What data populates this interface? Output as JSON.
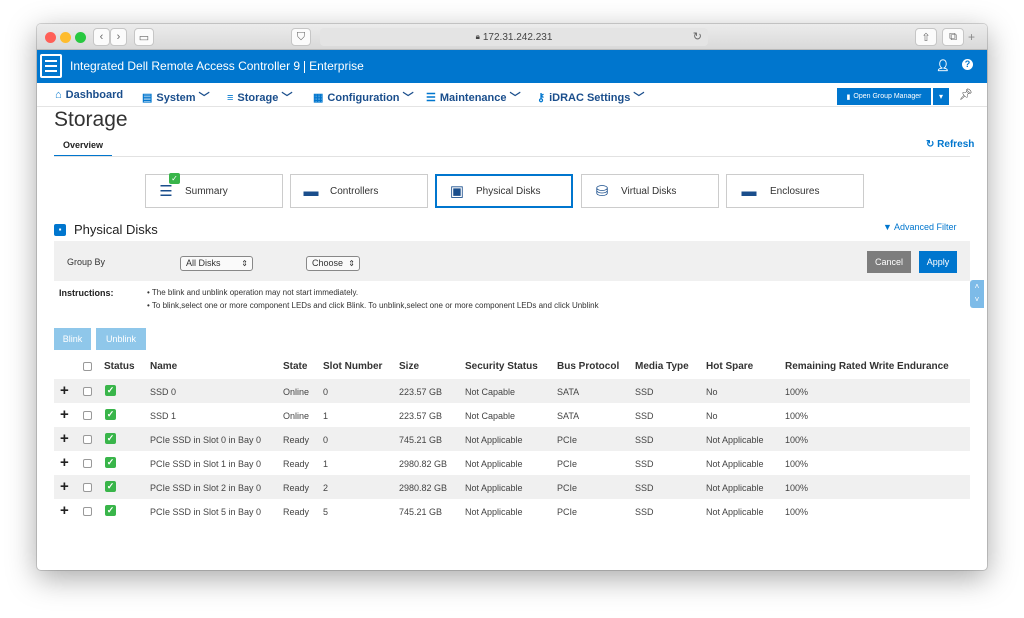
{
  "browser": {
    "url": "172.31.242.231",
    "nav_back": "‹",
    "nav_forward": "›"
  },
  "header": {
    "app_title": "Integrated Dell Remote Access Controller 9",
    "edition": "Enterprise",
    "user_icon": "user-icon",
    "help_icon": "help-icon"
  },
  "nav": {
    "items": [
      {
        "label": "Dashboard",
        "icon": "home-icon"
      },
      {
        "label": "System",
        "icon": "server-icon"
      },
      {
        "label": "Storage",
        "icon": "storage-icon"
      },
      {
        "label": "Configuration",
        "icon": "config-icon"
      },
      {
        "label": "Maintenance",
        "icon": "maintenance-icon"
      },
      {
        "label": "iDRAC Settings",
        "icon": "key-icon"
      }
    ],
    "group_manager": "Open Group Manager"
  },
  "page": {
    "title": "Storage",
    "tab": "Overview",
    "refresh": "Refresh"
  },
  "cards": [
    {
      "label": "Summary",
      "icon": "summary-icon"
    },
    {
      "label": "Controllers",
      "icon": "controller-icon"
    },
    {
      "label": "Physical Disks",
      "icon": "disk-icon"
    },
    {
      "label": "Virtual Disks",
      "icon": "virtual-disk-icon"
    },
    {
      "label": "Enclosures",
      "icon": "enclosure-icon"
    }
  ],
  "section": {
    "title": "Physical Disks",
    "advanced_filter": "Advanced Filter",
    "group_by_label": "Group By",
    "group_by_value": "All Disks",
    "choose_value": "Choose",
    "cancel": "Cancel",
    "apply": "Apply",
    "instructions_label": "Instructions:",
    "instructions": [
      "The blink and unblink operation may not start immediately.",
      "To blink,select one or more component LEDs and click Blink. To unblink,select one or more component LEDs and click Unblink"
    ],
    "blink": "Blink",
    "unblink": "Unblink"
  },
  "table": {
    "headers": [
      "Status",
      "Name",
      "State",
      "Slot Number",
      "Size",
      "Security Status",
      "Bus Protocol",
      "Media Type",
      "Hot Spare",
      "Remaining Rated Write Endurance"
    ],
    "rows": [
      [
        "SSD 0",
        "Online",
        "0",
        "223.57 GB",
        "Not Capable",
        "SATA",
        "SSD",
        "No",
        "100%"
      ],
      [
        "SSD 1",
        "Online",
        "1",
        "223.57 GB",
        "Not Capable",
        "SATA",
        "SSD",
        "No",
        "100%"
      ],
      [
        "PCIe SSD in Slot 0 in Bay 0",
        "Ready",
        "0",
        "745.21 GB",
        "Not Applicable",
        "PCIe",
        "SSD",
        "Not Applicable",
        "100%"
      ],
      [
        "PCIe SSD in Slot 1 in Bay 0",
        "Ready",
        "1",
        "2980.82 GB",
        "Not Applicable",
        "PCIe",
        "SSD",
        "Not Applicable",
        "100%"
      ],
      [
        "PCIe SSD in Slot 2 in Bay 0",
        "Ready",
        "2",
        "2980.82 GB",
        "Not Applicable",
        "PCIe",
        "SSD",
        "Not Applicable",
        "100%"
      ],
      [
        "PCIe SSD in Slot 5 in Bay 0",
        "Ready",
        "5",
        "745.21 GB",
        "Not Applicable",
        "PCIe",
        "SSD",
        "Not Applicable",
        "100%"
      ]
    ]
  }
}
